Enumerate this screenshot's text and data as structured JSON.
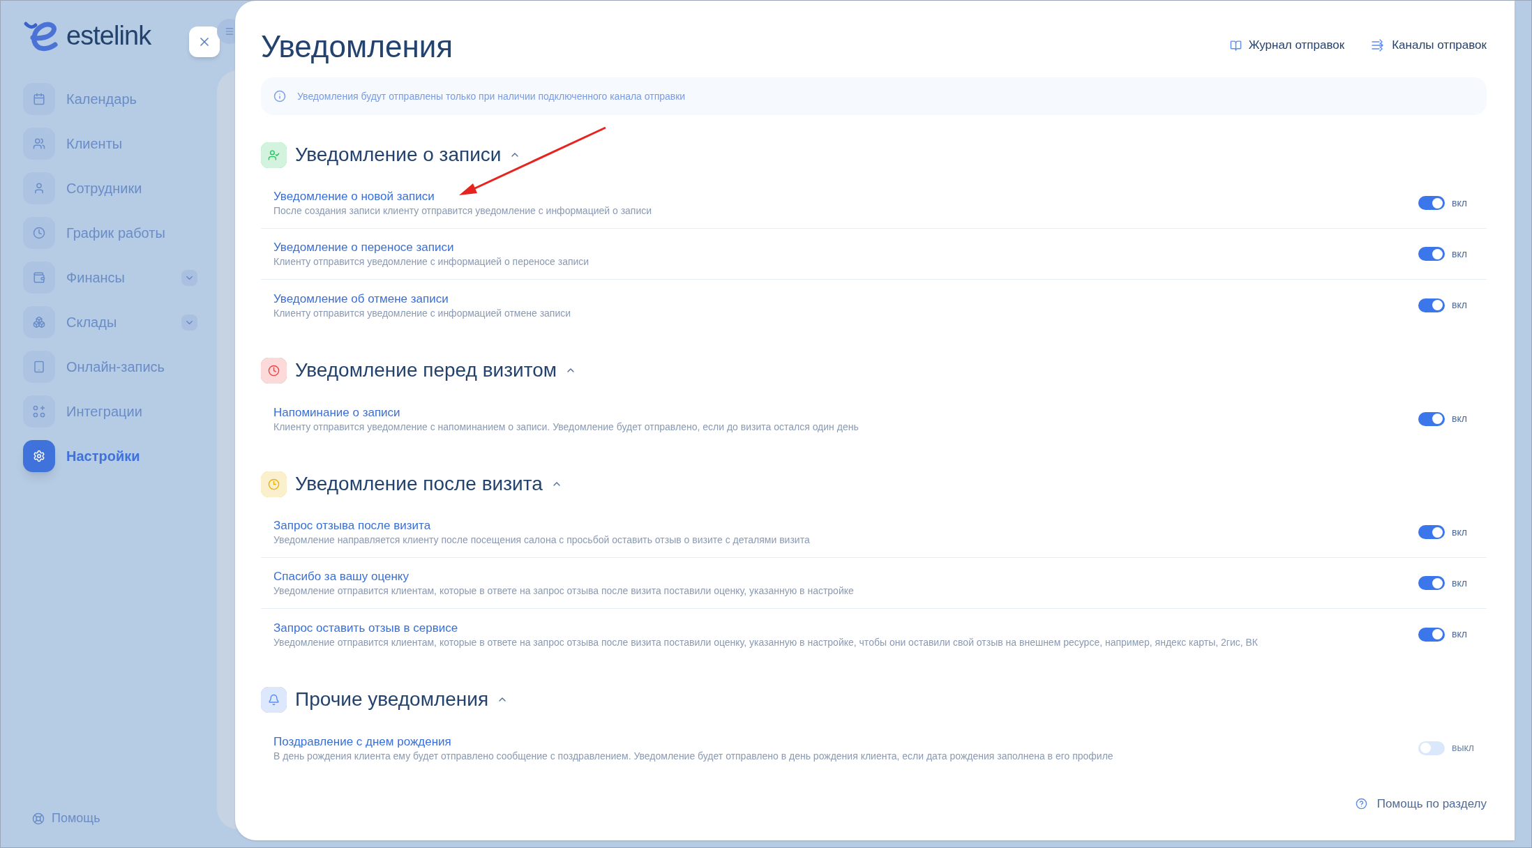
{
  "sidebar": {
    "logo": "estelink",
    "items": [
      {
        "label": "Календарь",
        "selected": false,
        "expandable": false
      },
      {
        "label": "Клиенты",
        "selected": false,
        "expandable": false
      },
      {
        "label": "Сотрудники",
        "selected": false,
        "expandable": false
      },
      {
        "label": "График работы",
        "selected": false,
        "expandable": false
      },
      {
        "label": "Финансы",
        "selected": false,
        "expandable": true
      },
      {
        "label": "Склады",
        "selected": false,
        "expandable": true
      },
      {
        "label": "Онлайн-запись",
        "selected": false,
        "expandable": false
      },
      {
        "label": "Интеграции",
        "selected": false,
        "expandable": false
      },
      {
        "label": "Настройки",
        "selected": true,
        "expandable": false
      }
    ],
    "help": "Помощь"
  },
  "header": {
    "title": "Уведомления",
    "links": [
      "Журнал отправок",
      "Каналы отправок"
    ]
  },
  "info": "Уведомления будут отправлены только при наличии подключенного канала отправки",
  "sections": [
    {
      "title": "Уведомление о записи",
      "color": "#22c55e",
      "expanded": true,
      "items": [
        {
          "title": "Уведомление о новой записи",
          "description": "После создания записи клиенту отправится уведомление с информацией о записи",
          "on": true,
          "state_label": "вкл"
        },
        {
          "title": "Уведомление о переносе записи",
          "description": "Клиенту отправится уведомление с информацией о переносе записи",
          "on": true,
          "state_label": "вкл"
        },
        {
          "title": "Уведомление об отмене записи",
          "description": "Клиенту отправится уведомление с информацией отмене записи",
          "on": true,
          "state_label": "вкл"
        }
      ]
    },
    {
      "title": "Уведомление перед визитом",
      "color": "#ef4444",
      "expanded": true,
      "items": [
        {
          "title": "Напоминание о записи",
          "description": "Клиенту отправится уведомление с напоминанием о записи. Уведомление будет отправлено, если до визита остался один день",
          "on": true,
          "state_label": "вкл"
        }
      ]
    },
    {
      "title": "Уведомление после визита",
      "color": "#eab308",
      "expanded": true,
      "items": [
        {
          "title": "Запрос отзыва после визита",
          "description": "Уведомление направляется клиенту после посещения салона с просьбой оставить отзыв о визите с деталями визита",
          "on": true,
          "state_label": "вкл"
        },
        {
          "title": "Спасибо за вашу оценку",
          "description": "Уведомление отправится клиентам, которые в ответе на запрос отзыва после визита поставили оценку, указанную в настройке",
          "on": true,
          "state_label": "вкл"
        },
        {
          "title": "Запрос оставить отзыв в сервисе",
          "description": "Уведомление отправится клиентам, которые в ответе на запрос отзыва после визита поставили оценку, указанную в настройке, чтобы они оставили свой отзыв на внешнем ресурсе, например, яндекс карты, 2гис, ВК",
          "on": true,
          "state_label": "вкл"
        }
      ]
    },
    {
      "title": "Прочие уведомления",
      "color": "#5b8def",
      "expanded": true,
      "items": [
        {
          "title": "Поздравление с днем рождения",
          "description": "В день рождения клиента ему будет отправлено сообщение с поздравлением. Уведомление будет отправлено в день рождения клиента, если дата рождения заполнена в его профиле",
          "on": false,
          "state_label": "выкл"
        }
      ]
    }
  ],
  "footer_help": "Помощь по разделу"
}
